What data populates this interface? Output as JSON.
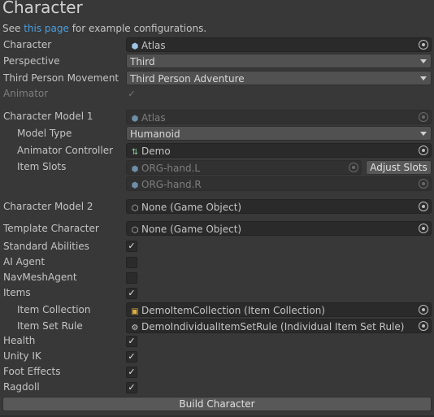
{
  "title": "Character",
  "intro": {
    "prefix": "See ",
    "link_text": "this page",
    "suffix": " for example configurations."
  },
  "fields": {
    "character": {
      "label": "Character",
      "value": "Atlas"
    },
    "perspective": {
      "label": "Perspective",
      "value": "Third"
    },
    "third_person_movement": {
      "label": "Third Person Movement",
      "value": "Third Person Adventure"
    },
    "animator": {
      "label": "Animator",
      "checked": true
    },
    "character_model_1": {
      "label": "Character Model 1",
      "value": "Atlas"
    },
    "model_type": {
      "label": "Model Type",
      "value": "Humanoid"
    },
    "animator_controller": {
      "label": "Animator Controller",
      "value": "Demo"
    },
    "item_slots": {
      "label": "Item Slots",
      "slots": [
        "ORG-hand.L",
        "ORG-hand.R"
      ],
      "button": "Adjust Slots"
    },
    "character_model_2": {
      "label": "Character Model 2",
      "value": "None (Game Object)"
    },
    "template_character": {
      "label": "Template Character",
      "value": "None (Game Object)"
    },
    "standard_abilities": {
      "label": "Standard Abilities",
      "checked": true
    },
    "ai_agent": {
      "label": "AI Agent",
      "checked": false
    },
    "navmesh_agent": {
      "label": "NavMeshAgent",
      "checked": false
    },
    "items": {
      "label": "Items",
      "checked": true
    },
    "item_collection": {
      "label": "Item Collection",
      "value": "DemoItemCollection (Item Collection)"
    },
    "item_set_rule": {
      "label": "Item Set Rule",
      "value": "DemoIndividualItemSetRule (Individual Item Set Rule)"
    },
    "health": {
      "label": "Health",
      "checked": true
    },
    "unity_ik": {
      "label": "Unity IK",
      "checked": true
    },
    "foot_effects": {
      "label": "Foot Effects",
      "checked": true
    },
    "ragdoll": {
      "label": "Ragdoll",
      "checked": true
    }
  },
  "build_button": "Build Character",
  "icons": {
    "object_field": "prefab-cube-icon",
    "controller": "animator-controller-icon",
    "collection": "item-collection-icon",
    "rule": "item-set-rule-icon",
    "picker": "object-picker-icon",
    "dropdown": "dropdown-arrow-icon",
    "check": "checkmark-icon"
  },
  "colors": {
    "background": "#383838",
    "link": "#4a9fe0",
    "field": "#2a2a2a",
    "button": "#585858"
  }
}
